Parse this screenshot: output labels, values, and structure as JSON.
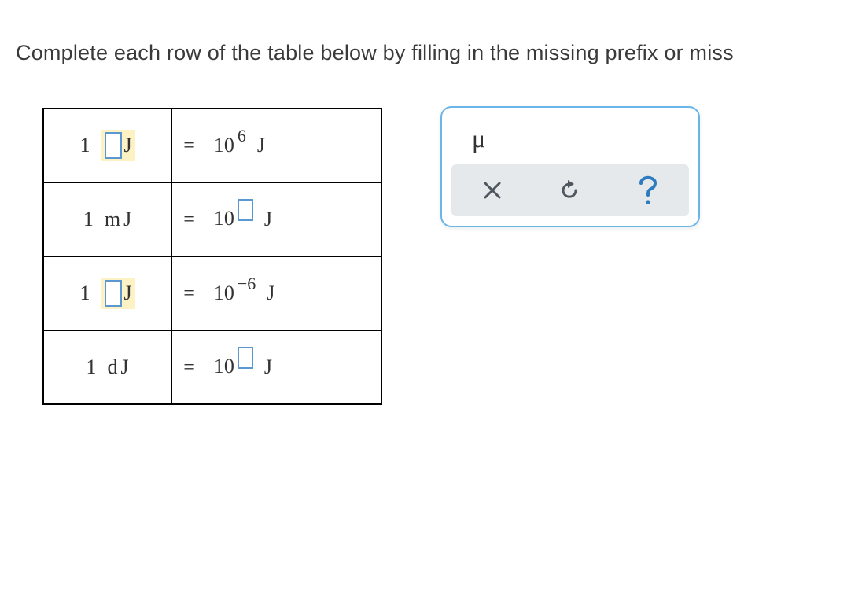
{
  "instruction": "Complete each row of the table below by filling in the missing prefix or miss",
  "rows": [
    {
      "left_one": "1",
      "left_prefix_value": "",
      "left_prefix_is_input": true,
      "left_highlight": true,
      "left_unit": "J",
      "right_eq": "=",
      "right_base": "10",
      "right_exp_value": "6",
      "right_exp_is_input": false,
      "right_unit": "J"
    },
    {
      "left_one": "1",
      "left_prefix_value": "m",
      "left_prefix_is_input": false,
      "left_highlight": false,
      "left_unit": "J",
      "right_eq": "=",
      "right_base": "10",
      "right_exp_value": "",
      "right_exp_is_input": true,
      "right_unit": "J"
    },
    {
      "left_one": "1",
      "left_prefix_value": "",
      "left_prefix_is_input": true,
      "left_highlight": true,
      "left_unit": "J",
      "right_eq": "=",
      "right_base": "10",
      "right_exp_value": "−6",
      "right_exp_is_input": false,
      "right_unit": "J"
    },
    {
      "left_one": "1",
      "left_prefix_value": "d",
      "left_prefix_is_input": false,
      "left_highlight": false,
      "left_unit": "J",
      "right_eq": "=",
      "right_base": "10",
      "right_exp_value": "",
      "right_exp_is_input": true,
      "right_unit": "J"
    }
  ],
  "toolbox": {
    "mu_symbol": "μ",
    "clear_label": "clear",
    "reset_label": "reset",
    "help_label": "help"
  },
  "colors": {
    "panel_border": "#6bb6e8",
    "input_border": "#5b97d1",
    "highlight_bg": "#fdf2c4",
    "action_bg": "#e6e9ec",
    "icon_gray": "#4f575e",
    "icon_blue": "#2e7bbf"
  }
}
